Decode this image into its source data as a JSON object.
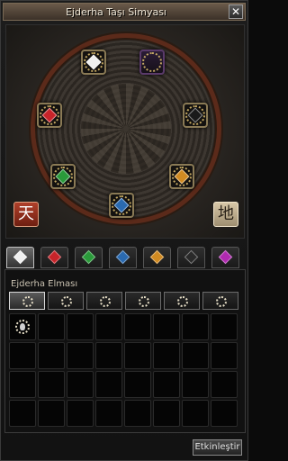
{
  "window": {
    "title": "Ejderha Taşı Simyası",
    "close_label": "✕"
  },
  "board": {
    "slots": [
      {
        "name": "slot-top-left",
        "gem_color": "#f0f0f0",
        "filled": true
      },
      {
        "name": "slot-top-right",
        "gem_color": "#3a2050",
        "filled": false
      },
      {
        "name": "slot-left",
        "gem_color": "#c8242a",
        "filled": true
      },
      {
        "name": "slot-right",
        "gem_color": "#1a1a1a",
        "filled": true
      },
      {
        "name": "slot-bottom-left",
        "gem_color": "#2a9a3a",
        "filled": true
      },
      {
        "name": "slot-bottom-right",
        "gem_color": "#d08a22",
        "filled": true
      },
      {
        "name": "slot-bottom",
        "gem_color": "#2a6ab0",
        "filled": true
      }
    ],
    "seal_left": "天",
    "seal_right": "地"
  },
  "tabs": [
    {
      "name": "tab-diamond",
      "color": "#f0f0f0",
      "active": true
    },
    {
      "name": "tab-ruby",
      "color": "#c8242a",
      "active": false
    },
    {
      "name": "tab-jade",
      "color": "#2a9a3a",
      "active": false
    },
    {
      "name": "tab-sapphire",
      "color": "#2a6ab0",
      "active": false
    },
    {
      "name": "tab-garnet",
      "color": "#d08a22",
      "active": false
    },
    {
      "name": "tab-onyx",
      "color": "#2a2a2a",
      "active": false
    },
    {
      "name": "tab-amethyst",
      "color": "#b02ab0",
      "active": false
    }
  ],
  "section": {
    "label": "Ejderha Elması"
  },
  "grades": [
    {
      "active": true
    },
    {
      "active": false
    },
    {
      "active": false
    },
    {
      "active": false
    },
    {
      "active": false
    },
    {
      "active": false
    }
  ],
  "inventory": {
    "filled_cells": [
      0
    ]
  },
  "footer": {
    "button_label": "Etkinleştir"
  }
}
